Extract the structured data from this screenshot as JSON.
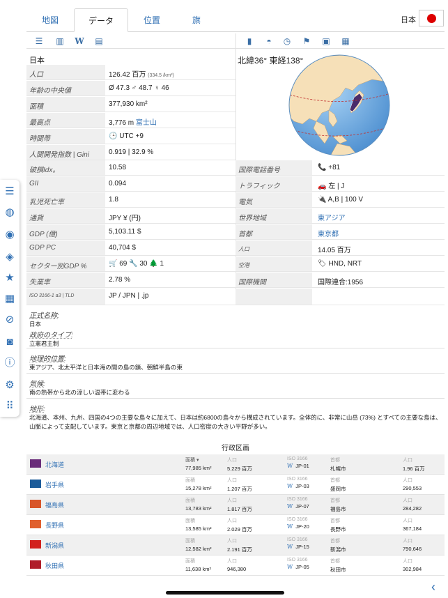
{
  "tabs": [
    "地図",
    "データ",
    "位置",
    "旗"
  ],
  "country_label": "日本",
  "left": {
    "name": "日本",
    "rows": [
      {
        "label": "人口",
        "value": "126.42 百万",
        "note": "(334.5 /km²)"
      },
      {
        "label": "年齢の中央値",
        "value": "Ø 47.3  ♂ 48.7  ♀ 46"
      },
      {
        "label": "面積",
        "value": "377,930 km²"
      },
      {
        "label": "最高点",
        "value": "3,776 m",
        "link": "富士山"
      },
      {
        "label": "時間帯",
        "value": "🕒 UTC +9"
      },
      {
        "label": "人間開発指数 | Gini",
        "value": "0.919 | 32.9 %"
      },
      {
        "label": "破損Idx。",
        "value": "10.58"
      },
      {
        "label": "GII",
        "value": "0.094"
      },
      {
        "label": "乳児死亡率",
        "value": "1.8"
      },
      {
        "label": "通貨",
        "value": "JPY ¥ (円)"
      },
      {
        "label": "GDP (億)",
        "value": "5,103.11 $"
      },
      {
        "label": "GDP PC",
        "value": "40,704 $"
      },
      {
        "label": "セクター別GDP %",
        "value": "🛒 69  🔧 30  🌲 1"
      },
      {
        "label": "失業率",
        "value": "2.78 %"
      },
      {
        "label": "ISO 3166-1 a3 | TLD",
        "value": "JP / JPN   |   .jp"
      }
    ]
  },
  "right": {
    "coords": "北緯36° 東経138°",
    "rows": [
      {
        "label": "国際電話番号",
        "value": "📞 +81"
      },
      {
        "label": "トラフィック",
        "value": "🚗 左 | J"
      },
      {
        "label": "電気",
        "value": "🔌 A,B | 100 V"
      },
      {
        "label": "世界地域",
        "value": "東アジア",
        "link": true
      },
      {
        "label": "首都",
        "value": "東京都",
        "link": true
      },
      {
        "label": "人口",
        "value": "14.05 百万"
      },
      {
        "label": "空港",
        "value": "🏷 HND, NRT"
      },
      {
        "label": "国際機関",
        "value": "国際連合:1956"
      }
    ]
  },
  "official": {
    "h1": "正式名称:",
    "t1": "日本",
    "h2": "政府のタイプ:",
    "t2": "立憲君主制"
  },
  "geo_location": {
    "h": "地理的位置:",
    "t": "東アジア、北太平洋と日本海の間の島の鎖、朝鮮半島の東"
  },
  "climate": {
    "h": "気候:",
    "t": "南の熱帯から北の涼しい温帯に変わる"
  },
  "terrain": {
    "h": "地形:",
    "t": "北海道、本州、九州、四国の4つの主要な島々に加えて、日本は約6800の島々から構成されています。全体的に、非常に山岳 (73%) とすべての主要な島は、山脈によって支配しています。東京と京都の周辺地域では、人口密度の大きい平野が多い。"
  },
  "admin": {
    "title": "行政区画",
    "headers": {
      "area": "面積",
      "pop": "人口",
      "iso": "ISO 3166",
      "capital": "首都"
    },
    "rows": [
      {
        "name": "北海道",
        "area": "77,985 km²",
        "pop": "5.229 百万",
        "iso": "JP-01",
        "capital": "札幌市",
        "cap_pop": "1.96 百万",
        "flag": "#6a2c7a"
      },
      {
        "name": "岩手県",
        "area": "15,278 km²",
        "pop": "1.207 百万",
        "iso": "JP-03",
        "capital": "盛岡市",
        "cap_pop": "290,553",
        "flag": "#1c5c9a"
      },
      {
        "name": "福島県",
        "area": "13,783 km²",
        "pop": "1.817 百万",
        "iso": "JP-07",
        "capital": "福島市",
        "cap_pop": "284,282",
        "flag": "#d8562a"
      },
      {
        "name": "長野県",
        "area": "13,585 km²",
        "pop": "2.029 百万",
        "iso": "JP-20",
        "capital": "長野市",
        "cap_pop": "367,184",
        "flag": "#e0602e"
      },
      {
        "name": "新潟県",
        "area": "12,582 km²",
        "pop": "2.191 百万",
        "iso": "JP-15",
        "capital": "新潟市",
        "cap_pop": "790,646",
        "flag": "#d2201c"
      },
      {
        "name": "秋田県",
        "area": "11,638 km²",
        "pop": "946,380",
        "iso": "JP-05",
        "capital": "秋田市",
        "cap_pop": "302,984",
        "flag": "#b01e2a"
      }
    ]
  }
}
